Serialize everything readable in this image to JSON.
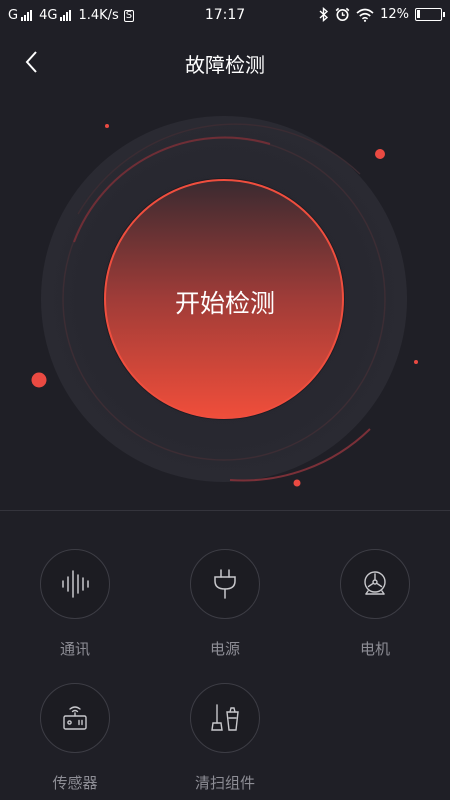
{
  "status_bar": {
    "carrier1": "G",
    "carrier2": "4G",
    "speed": "1.4K/s",
    "speed_badge": "S",
    "time": "17:17",
    "battery": "12%",
    "icons": [
      "bluetooth-icon",
      "alarm-icon",
      "wifi-icon",
      "battery-icon"
    ]
  },
  "header": {
    "title": "故障检测",
    "back_icon": "chevron-left-icon"
  },
  "hero": {
    "button_label": "开始检测",
    "colors": {
      "gradient_top": "#3c2a30",
      "gradient_bottom": "#ee4e3a",
      "accent": "#ee4b3d"
    }
  },
  "categories": [
    {
      "label": "通讯",
      "icon": "waveform-icon"
    },
    {
      "label": "电源",
      "icon": "plug-icon"
    },
    {
      "label": "电机",
      "icon": "motor-icon"
    },
    {
      "label": "传感器",
      "icon": "sensor-icon"
    },
    {
      "label": "清扫组件",
      "icon": "cleaning-icon"
    }
  ]
}
